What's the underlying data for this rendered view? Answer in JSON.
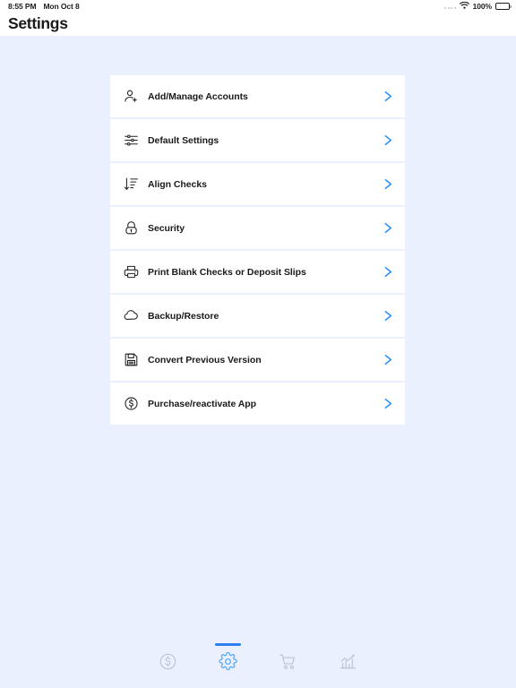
{
  "status_bar": {
    "time": "8:55 PM",
    "date": "Mon Oct 8",
    "battery_percent": "100%",
    "signal_icon": "signal-dots-icon",
    "wifi_icon": "wifi-icon",
    "battery_icon": "battery-full-icon"
  },
  "header": {
    "title": "Settings"
  },
  "colors": {
    "background": "#eaf0fd",
    "card": "#ffffff",
    "accent_chevron": "#2f93f5",
    "accent_tab_active": "#56a8f7",
    "accent_tab_indicator": "#2f7ef0",
    "tab_inactive": "#b9c4d4",
    "text_primary": "#1a1a1a"
  },
  "settings": {
    "items": [
      {
        "label": "Add/Manage Accounts",
        "icon": "person-add-icon",
        "chevron": "chevron-right-icon"
      },
      {
        "label": "Default Settings",
        "icon": "sliders-icon",
        "chevron": "chevron-right-icon"
      },
      {
        "label": "Align Checks",
        "icon": "sort-descending-icon",
        "chevron": "chevron-right-icon"
      },
      {
        "label": "Security",
        "icon": "lock-icon",
        "chevron": "chevron-right-icon"
      },
      {
        "label": "Print Blank Checks or Deposit Slips",
        "icon": "printer-icon",
        "chevron": "chevron-right-icon"
      },
      {
        "label": "Backup/Restore",
        "icon": "cloud-icon",
        "chevron": "chevron-right-icon"
      },
      {
        "label": "Convert Previous Version",
        "icon": "floppy-disk-icon",
        "chevron": "chevron-right-icon"
      },
      {
        "label": "Purchase/reactivate App",
        "icon": "dollar-circle-icon",
        "chevron": "chevron-right-icon"
      }
    ]
  },
  "tab_bar": {
    "items": [
      {
        "name": "dollar-circle-icon",
        "active": false
      },
      {
        "name": "gear-icon",
        "active": true
      },
      {
        "name": "cart-icon",
        "active": false
      },
      {
        "name": "chart-icon",
        "active": false
      }
    ]
  }
}
